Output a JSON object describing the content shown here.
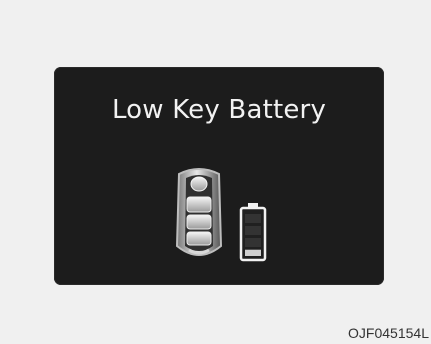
{
  "display": {
    "warning_text": "Low Key Battery",
    "icons": [
      "smart-key-fob-icon",
      "low-battery-icon"
    ],
    "battery_level": 0.15,
    "colors": {
      "panel_background": "#1c1c1c",
      "text": "#f2f2f2",
      "page_background": "#f0f0f0"
    }
  },
  "figure": {
    "code": "OJF045154L"
  }
}
